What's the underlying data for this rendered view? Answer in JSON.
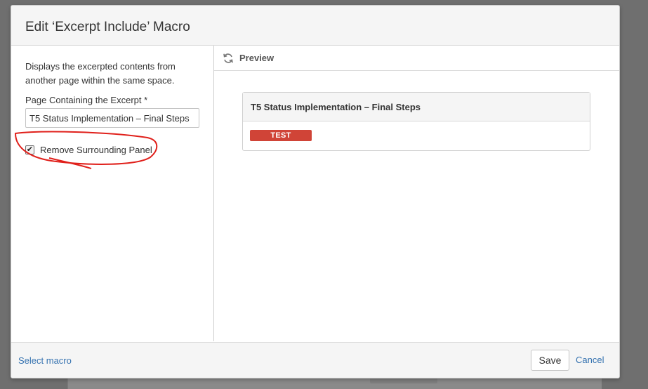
{
  "dialog": {
    "title": "Edit ‘Excerpt Include’ Macro"
  },
  "form": {
    "description": "Displays the excerpted contents from another page within the same space.",
    "page_label": "Page Containing the Excerpt *",
    "page_value": "T5 Status Implementation – Final Steps",
    "checkbox_label": "Remove Surrounding Panel",
    "checkbox_checked": true
  },
  "preview": {
    "label": "Preview",
    "panel_title": "T5 Status Implementation – Final Steps",
    "badge": "TEST",
    "badge_color": "#d04437"
  },
  "footer": {
    "select_macro": "Select macro",
    "save": "Save",
    "cancel": "Cancel"
  },
  "icons": {
    "refresh": "refresh-icon",
    "check": "✔"
  },
  "annotation": {
    "color": "#e0201b"
  }
}
